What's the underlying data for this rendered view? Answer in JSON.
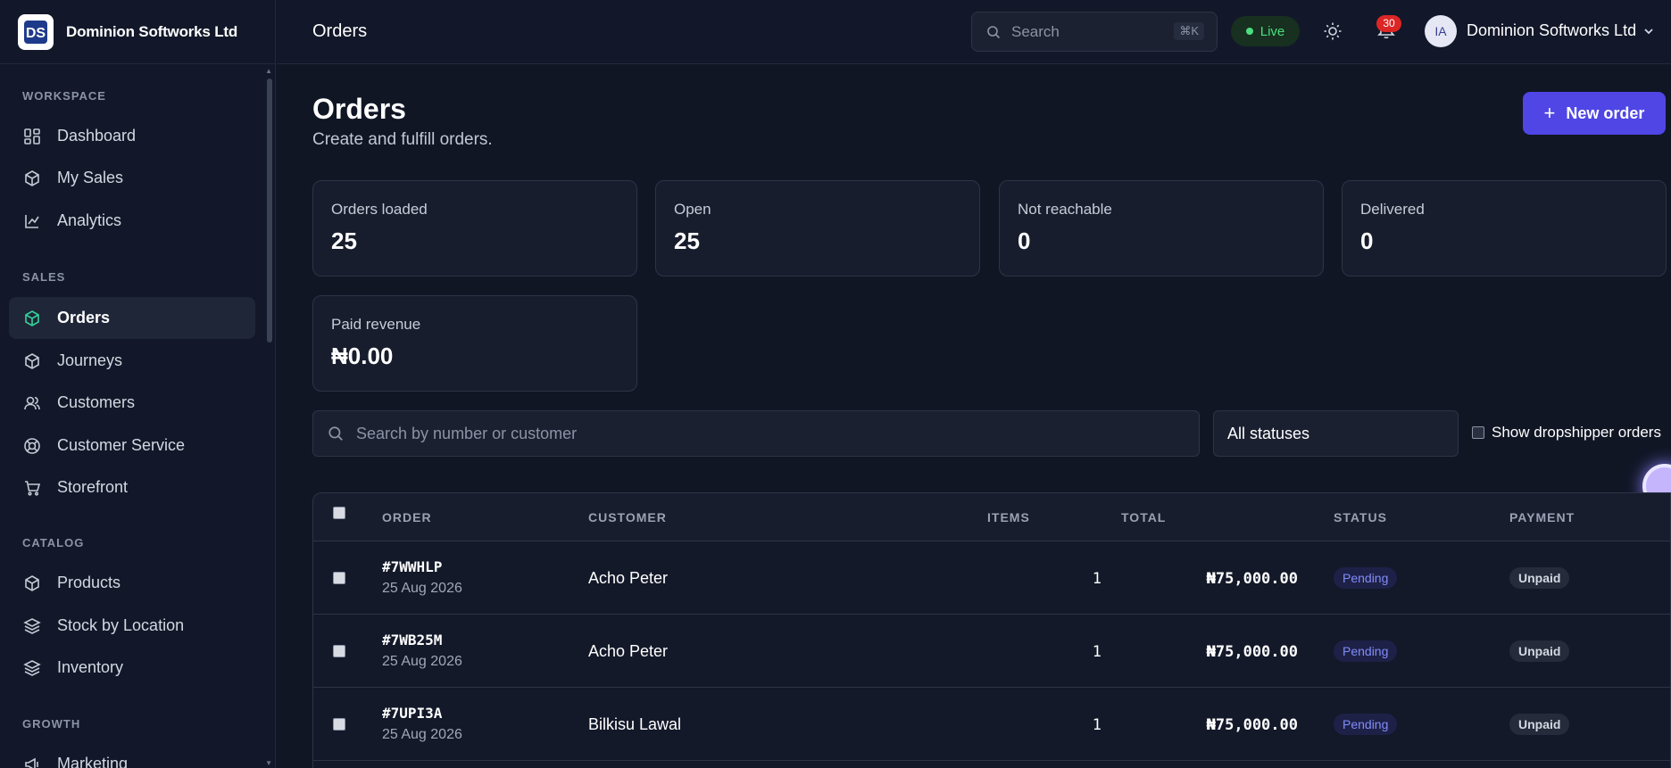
{
  "brand": {
    "name": "Dominion Softworks Ltd"
  },
  "sidebar": {
    "sections": [
      {
        "title": "WORKSPACE",
        "items": [
          {
            "label": "Dashboard",
            "icon": "dashboard-icon"
          },
          {
            "label": "My Sales",
            "icon": "box-icon"
          },
          {
            "label": "Analytics",
            "icon": "chart-line-icon"
          }
        ]
      },
      {
        "title": "SALES",
        "items": [
          {
            "label": "Orders",
            "icon": "box-icon",
            "active": true
          },
          {
            "label": "Journeys",
            "icon": "box-icon"
          },
          {
            "label": "Customers",
            "icon": "users-icon"
          },
          {
            "label": "Customer Service",
            "icon": "lifebuoy-icon"
          },
          {
            "label": "Storefront",
            "icon": "cart-icon"
          }
        ]
      },
      {
        "title": "CATALOG",
        "items": [
          {
            "label": "Products",
            "icon": "box-icon"
          },
          {
            "label": "Stock by Location",
            "icon": "layers-icon"
          },
          {
            "label": "Inventory",
            "icon": "layers-icon"
          }
        ]
      },
      {
        "title": "GROWTH",
        "items": [
          {
            "label": "Marketing",
            "icon": "megaphone-icon"
          }
        ]
      }
    ]
  },
  "header": {
    "title": "Orders",
    "search_placeholder": "Search",
    "search_shortcut": "⌘K",
    "live_label": "Live",
    "notification_count": "30",
    "user_initials": "IA",
    "user_name": "Dominion Softworks Ltd"
  },
  "main": {
    "title": "Orders",
    "subtitle": "Create and fulfill orders.",
    "new_order_label": "New order",
    "stats": [
      {
        "label": "Orders loaded",
        "value": "25"
      },
      {
        "label": "Open",
        "value": "25"
      },
      {
        "label": "Not reachable",
        "value": "0"
      },
      {
        "label": "Delivered",
        "value": "0"
      },
      {
        "label": "Paid revenue",
        "value": "₦0.00"
      }
    ],
    "filter": {
      "search_placeholder": "Search by number or customer",
      "status_value": "All statuses",
      "dropshipper_label": "Show dropshipper orders"
    }
  },
  "table": {
    "columns": [
      "ORDER",
      "CUSTOMER",
      "ITEMS",
      "TOTAL",
      "STATUS",
      "PAYMENT"
    ],
    "rows": [
      {
        "order": "#7WWHLP",
        "date": "25 Aug 2026",
        "customer": "Acho Peter",
        "items": "1",
        "total": "₦75,000.00",
        "status": "Pending",
        "payment": "Unpaid"
      },
      {
        "order": "#7WB25M",
        "date": "25 Aug 2026",
        "customer": "Acho Peter",
        "items": "1",
        "total": "₦75,000.00",
        "status": "Pending",
        "payment": "Unpaid"
      },
      {
        "order": "#7UPI3A",
        "date": "25 Aug 2026",
        "customer": "Bilkisu Lawal",
        "items": "1",
        "total": "₦75,000.00",
        "status": "Pending",
        "payment": "Unpaid"
      }
    ]
  },
  "colors": {
    "accent": "#4f46e5",
    "live": "#4ade80",
    "badge": "#dc2626",
    "pending": "#818cf8"
  }
}
